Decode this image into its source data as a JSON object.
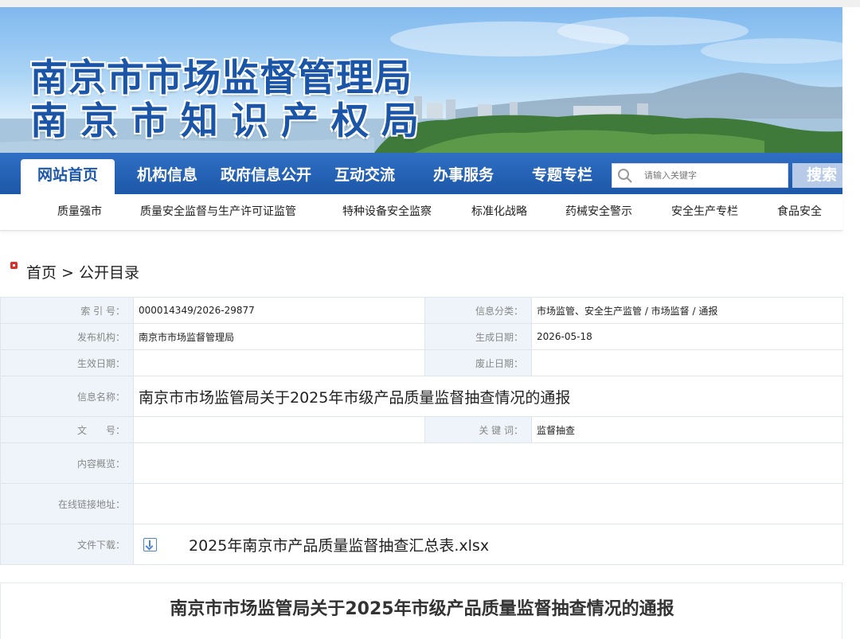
{
  "banner": {
    "title_line1": "南京市市场监督管理局",
    "title_line2": "南京市知识产权局"
  },
  "nav": {
    "items": [
      {
        "label": "网站首页",
        "active": true
      },
      {
        "label": "机构信息",
        "active": false
      },
      {
        "label": "政府信息公开",
        "active": false
      },
      {
        "label": "互动交流",
        "active": false
      },
      {
        "label": "办事服务",
        "active": false
      },
      {
        "label": "专题专栏",
        "active": false
      }
    ],
    "search_placeholder": "请输入关键字",
    "search_button": "搜索"
  },
  "subnav": {
    "items": [
      "质量强市",
      "质量安全监督与生产许可证监管",
      "特种设备安全监察",
      "标准化战略",
      "药械安全警示",
      "安全生产专栏",
      "食品安全"
    ]
  },
  "breadcrumb": {
    "home": "首页",
    "separator": " > ",
    "current": "公开目录"
  },
  "info": {
    "index_label": "索 引 号：",
    "index_value": "000014349/2026-29877",
    "category_label": "信息分类：",
    "category_value": "市场监管、安全生产监管 / 市场监督 / 通报",
    "publisher_label": "发布机构：",
    "publisher_value": "南京市市场监督管理局",
    "created_label": "生成日期：",
    "created_value": "2026-05-18",
    "effective_label": "生效日期：",
    "effective_value": "",
    "expire_label": "废止日期：",
    "expire_value": "",
    "name_label": "信息名称：",
    "name_value": "南京市市场监管局关于2025年市级产品质量监督抽查情况的通报",
    "doc_no_label": "文　　号：",
    "doc_no_value": "",
    "keywords_label": "关 键 词：",
    "keywords_value": "监督抽查",
    "summary_label": "内容概览：",
    "summary_value": "",
    "link_label": "在线链接地址：",
    "link_value": "",
    "download_label": "文件下载：",
    "download_file": "2025年南京市产品质量监督抽查汇总表.xlsx"
  },
  "article": {
    "title": "南京市市场监管局关于2025年市级产品质量监督抽查情况的通报"
  },
  "colors": {
    "nav_blue": "#1d57a8",
    "title_blue": "#1a55a8",
    "label_bg": "#eef4f9",
    "crumb_red": "#d9302c"
  }
}
